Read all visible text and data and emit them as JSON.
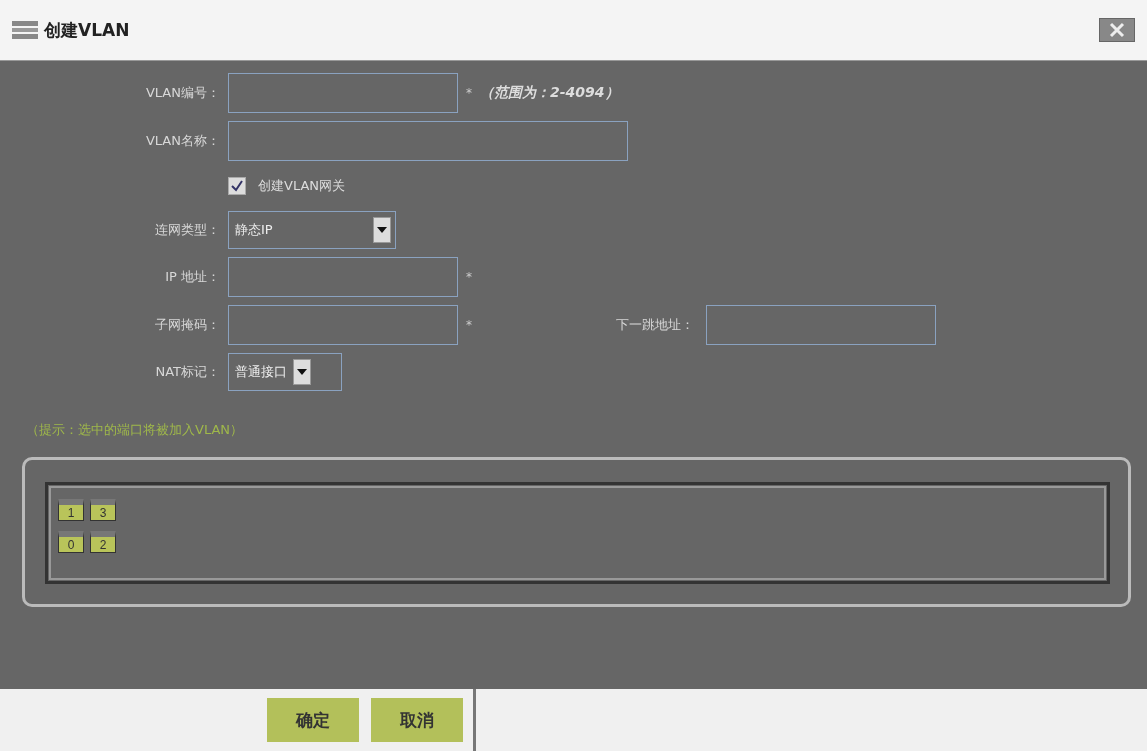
{
  "window": {
    "title": "创建VLAN"
  },
  "vlan_id": {
    "label": "VLAN编号：",
    "mark": "*",
    "note": "（范围为：2-4094）"
  },
  "vlan_name": {
    "label": "VLAN名称："
  },
  "create_gateway": {
    "label": "创建VLAN网关",
    "checked": true
  },
  "connection_type": {
    "label": "连网类型：",
    "value": "静态IP"
  },
  "ip_address": {
    "label": "IP 地址：",
    "mark": "*"
  },
  "subnet_mask": {
    "label": "子网掩码：",
    "mark": "*"
  },
  "next_hop": {
    "label": "下一跳地址："
  },
  "nat_mark": {
    "label": "NAT标记：",
    "value": "普通接口"
  },
  "hint": "（提示：选中的端口将被加入VLAN）",
  "ports": [
    [
      {
        "label": "1"
      },
      {
        "label": "3"
      }
    ],
    [
      {
        "label": "0"
      },
      {
        "label": "2"
      }
    ]
  ],
  "buttons": [
    "确定",
    "取消"
  ]
}
